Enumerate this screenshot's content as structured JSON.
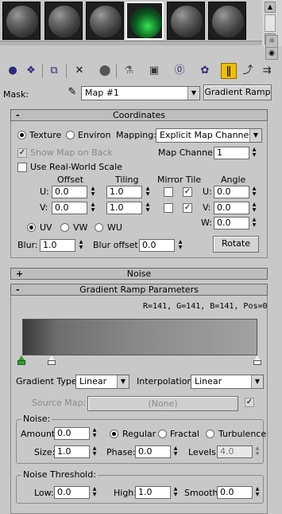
{
  "material_slots": [
    {
      "name": "material-slot-1",
      "selected": false,
      "sphere": "gray"
    },
    {
      "name": "material-slot-2",
      "selected": false,
      "sphere": "gray"
    },
    {
      "name": "material-slot-3",
      "selected": false,
      "sphere": "gray"
    },
    {
      "name": "material-slot-4",
      "selected": true,
      "sphere": "green"
    },
    {
      "name": "material-slot-5",
      "selected": false,
      "sphere": "gray"
    },
    {
      "name": "material-slot-6",
      "selected": false,
      "sphere": "gray"
    }
  ],
  "colors": {
    "selected_tool": "#f0c000",
    "gradient_flag_active": "#2fa02f",
    "panel_bg": "#c8c8c8"
  },
  "mask_row": {
    "label": "Mask:",
    "map_name": "Map #1",
    "type_button": "Gradient Ramp"
  },
  "coordinates": {
    "title": "Coordinates",
    "collapse_symbol": "-",
    "texture_label": "Texture",
    "environ_label": "Environ",
    "mapping_label": "Mapping:",
    "mapping_value": "Explicit Map Channel",
    "show_map_on_back": "Show Map on Back",
    "map_channel_label": "Map Channel:",
    "map_channel_value": "1",
    "real_world_scale": "Use Real-World Scale",
    "offset_header": "Offset",
    "tiling_header": "Tiling",
    "mirror_tile_header": "Mirror Tile",
    "angle_header": "Angle",
    "u_label": "U:",
    "v_label": "V:",
    "w_label": "W:",
    "offset_u": "0.0",
    "offset_v": "0.0",
    "tiling_u": "1.0",
    "tiling_v": "1.0",
    "angle_u": "0.0",
    "angle_v": "0.0",
    "angle_w": "0.0",
    "uv_label": "UV",
    "vw_label": "VW",
    "wu_label": "WU",
    "blur_label": "Blur:",
    "blur_value": "1.0",
    "blur_offset_label": "Blur offset:",
    "blur_offset_value": "0.0",
    "rotate_button": "Rotate"
  },
  "noise_rollout": {
    "title": "Noise",
    "collapse_symbol": "+"
  },
  "gradient_ramp": {
    "title": "Gradient Ramp Parameters",
    "collapse_symbol": "-",
    "info": "R=141, G=141, B=141,  Pos=0",
    "gradient_type_label": "Gradient Type:",
    "gradient_type_value": "Linear",
    "interpolation_label": "Interpolation:",
    "interpolation_value": "Linear",
    "source_map_label": "Source Map:",
    "source_map_value": "(None)",
    "noise_group_label": "Noise:",
    "amount_label": "Amount:",
    "amount_value": "0.0",
    "regular_label": "Regular",
    "fractal_label": "Fractal",
    "turbulence_label": "Turbulence",
    "size_label": "Size:",
    "size_value": "1.0",
    "phase_label": "Phase:",
    "phase_value": "0.0",
    "levels_label": "Levels:",
    "levels_value": "4.0",
    "noise_threshold_label": "Noise Threshold:",
    "low_label": "Low:",
    "low_value": "0.0",
    "high_label": "High:",
    "high_value": "1.0",
    "smooth_label": "Smooth:",
    "smooth_value": "0.0"
  },
  "toolbar_icons": [
    "get-material-icon",
    "put-to-scene-icon",
    "assign-material-icon",
    "reset-map-icon",
    "delete-icon",
    "make-unique-icon",
    "put-to-library-icon",
    "material-effects-channel-icon",
    "show-map-in-viewport-icon",
    "show-end-result-icon",
    "go-to-parent-icon",
    "go-forward-to-sibling-icon"
  ]
}
